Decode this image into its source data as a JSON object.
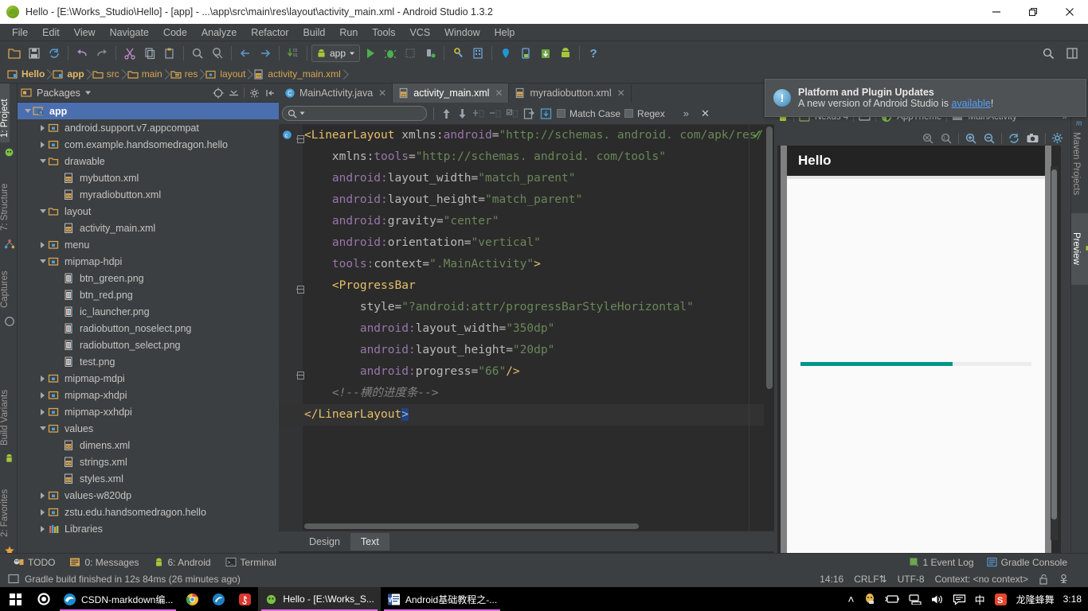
{
  "window": {
    "title": "Hello - [E:\\Works_Studio\\Hello] - [app] - ...\\app\\src\\main\\res\\layout\\activity_main.xml - Android Studio 1.3.2",
    "minimize": "—",
    "maximize": "❐",
    "close": "✕"
  },
  "menubar": {
    "items": [
      "File",
      "Edit",
      "View",
      "Navigate",
      "Code",
      "Analyze",
      "Refactor",
      "Build",
      "Run",
      "Tools",
      "VCS",
      "Window",
      "Help"
    ]
  },
  "toolbar": {
    "run_config": "app",
    "icons": [
      "open-folder-icon",
      "save-all-icon",
      "sync-icon",
      "undo-icon",
      "redo-icon",
      "cut-icon",
      "copy-icon",
      "paste-icon",
      "find-icon",
      "replace-icon",
      "back-icon",
      "forward-icon",
      "compile-icon"
    ],
    "search_everywhere": "search-icon",
    "help": "?"
  },
  "breadcrumb": {
    "items": [
      "Hello",
      "app",
      "src",
      "main",
      "res",
      "layout",
      "activity_main.xml"
    ]
  },
  "left_strip": {
    "tabs": [
      "1: Project",
      "7: Structure",
      "Captures",
      "Build Variants",
      "2: Favorites"
    ],
    "selected": "1: Project"
  },
  "right_strip": {
    "tabs": [
      "dle",
      "Maven Projects",
      "Preview"
    ],
    "selected": "Preview"
  },
  "project_panel": {
    "title": "Packages",
    "tree": [
      {
        "label": "app",
        "depth": 0,
        "arrow": "open",
        "icon": "module-icon",
        "selected": true,
        "bold": true
      },
      {
        "label": "android.support.v7.appcompat",
        "depth": 1,
        "arrow": "closed",
        "icon": "package-icon"
      },
      {
        "label": "com.example.handsomedragon.hello",
        "depth": 1,
        "arrow": "closed",
        "icon": "package-icon"
      },
      {
        "label": "drawable",
        "depth": 1,
        "arrow": "open",
        "icon": "folder-icon"
      },
      {
        "label": "mybutton.xml",
        "depth": 2,
        "arrow": "none",
        "icon": "xml-file-icon"
      },
      {
        "label": "myradiobutton.xml",
        "depth": 2,
        "arrow": "none",
        "icon": "xml-file-icon"
      },
      {
        "label": "layout",
        "depth": 1,
        "arrow": "open",
        "icon": "folder-icon"
      },
      {
        "label": "activity_main.xml",
        "depth": 2,
        "arrow": "none",
        "icon": "xml-file-icon"
      },
      {
        "label": "menu",
        "depth": 1,
        "arrow": "closed",
        "icon": "package-icon"
      },
      {
        "label": "mipmap-hdpi",
        "depth": 1,
        "arrow": "open",
        "icon": "package-icon"
      },
      {
        "label": "btn_green.png",
        "depth": 2,
        "arrow": "none",
        "icon": "image-file-icon"
      },
      {
        "label": "btn_red.png",
        "depth": 2,
        "arrow": "none",
        "icon": "image-file-icon"
      },
      {
        "label": "ic_launcher.png",
        "depth": 2,
        "arrow": "none",
        "icon": "image-file-icon"
      },
      {
        "label": "radiobutton_noselect.png",
        "depth": 2,
        "arrow": "none",
        "icon": "image-file-icon"
      },
      {
        "label": "radiobutton_select.png",
        "depth": 2,
        "arrow": "none",
        "icon": "image-file-icon"
      },
      {
        "label": "test.png",
        "depth": 2,
        "arrow": "none",
        "icon": "image-file-icon"
      },
      {
        "label": "mipmap-mdpi",
        "depth": 1,
        "arrow": "closed",
        "icon": "package-icon"
      },
      {
        "label": "mipmap-xhdpi",
        "depth": 1,
        "arrow": "closed",
        "icon": "package-icon"
      },
      {
        "label": "mipmap-xxhdpi",
        "depth": 1,
        "arrow": "closed",
        "icon": "package-icon"
      },
      {
        "label": "values",
        "depth": 1,
        "arrow": "open",
        "icon": "package-icon"
      },
      {
        "label": "dimens.xml",
        "depth": 2,
        "arrow": "none",
        "icon": "xml-file-icon"
      },
      {
        "label": "strings.xml",
        "depth": 2,
        "arrow": "none",
        "icon": "xml-file-icon"
      },
      {
        "label": "styles.xml",
        "depth": 2,
        "arrow": "none",
        "icon": "xml-file-icon"
      },
      {
        "label": "values-w820dp",
        "depth": 1,
        "arrow": "closed",
        "icon": "package-icon"
      },
      {
        "label": "zstu.edu.handsomedragon.hello",
        "depth": 1,
        "arrow": "closed",
        "icon": "package-icon"
      },
      {
        "label": "Libraries",
        "depth": 1,
        "arrow": "closed",
        "icon": "library-icon"
      }
    ]
  },
  "editor": {
    "tabs": [
      {
        "label": "MainActivity.java",
        "icon": "java-class-icon",
        "active": false
      },
      {
        "label": "activity_main.xml",
        "icon": "xml-file-icon",
        "active": true
      },
      {
        "label": "myradiobutton.xml",
        "icon": "xml-file-icon",
        "active": false
      }
    ],
    "find": {
      "value": "",
      "placeholder": "",
      "match_case": "Match Case",
      "regex": "Regex",
      "more": "»",
      "close": "✕"
    },
    "bottom_tabs": [
      {
        "label": "Design",
        "active": false
      },
      {
        "label": "Text",
        "active": true
      }
    ],
    "code_lines": [
      [
        {
          "t": "<LinearLayout ",
          "c": "tag"
        },
        {
          "t": "xmlns:",
          "c": "attr"
        },
        {
          "t": "android",
          "c": "ns"
        },
        {
          "t": "=",
          "c": "attr"
        },
        {
          "t": "\"http://schemas. android. com/apk/res/",
          "c": "val"
        }
      ],
      [
        {
          "t": "    xmlns:",
          "c": "attr"
        },
        {
          "t": "tools",
          "c": "ns"
        },
        {
          "t": "=",
          "c": "attr"
        },
        {
          "t": "\"http://schemas. android. com/tools\"",
          "c": "val"
        }
      ],
      [
        {
          "t": "    android:",
          "c": "ns"
        },
        {
          "t": "layout_width",
          "c": "attr"
        },
        {
          "t": "=",
          "c": "attr"
        },
        {
          "t": "\"match_parent\"",
          "c": "val"
        }
      ],
      [
        {
          "t": "    android:",
          "c": "ns"
        },
        {
          "t": "layout_height",
          "c": "attr"
        },
        {
          "t": "=",
          "c": "attr"
        },
        {
          "t": "\"match_parent\"",
          "c": "val"
        }
      ],
      [
        {
          "t": "    android:",
          "c": "ns"
        },
        {
          "t": "gravity",
          "c": "attr"
        },
        {
          "t": "=",
          "c": "attr"
        },
        {
          "t": "\"center\"",
          "c": "val"
        }
      ],
      [
        {
          "t": "    android:",
          "c": "ns"
        },
        {
          "t": "orientation",
          "c": "attr"
        },
        {
          "t": "=",
          "c": "attr"
        },
        {
          "t": "\"vertical\"",
          "c": "val"
        }
      ],
      [
        {
          "t": "    tools:",
          "c": "ns"
        },
        {
          "t": "context",
          "c": "attr"
        },
        {
          "t": "=",
          "c": "attr"
        },
        {
          "t": "\".MainActivity\"",
          "c": "val"
        },
        {
          "t": ">",
          "c": "tag"
        }
      ],
      [
        {
          "t": "    <ProgressBar",
          "c": "tag"
        }
      ],
      [
        {
          "t": "        style",
          "c": "attr"
        },
        {
          "t": "=",
          "c": "attr"
        },
        {
          "t": "\"?android:attr/progressBarStyleHorizontal\"",
          "c": "val"
        }
      ],
      [
        {
          "t": "        android:",
          "c": "ns"
        },
        {
          "t": "layout_width",
          "c": "attr"
        },
        {
          "t": "=",
          "c": "attr"
        },
        {
          "t": "\"350dp\"",
          "c": "val"
        }
      ],
      [
        {
          "t": "        android:",
          "c": "ns"
        },
        {
          "t": "layout_height",
          "c": "attr"
        },
        {
          "t": "=",
          "c": "attr"
        },
        {
          "t": "\"20dp\"",
          "c": "val"
        }
      ],
      [
        {
          "t": "        android:",
          "c": "ns"
        },
        {
          "t": "progress",
          "c": "attr"
        },
        {
          "t": "=",
          "c": "attr"
        },
        {
          "t": "\"66\"",
          "c": "val"
        },
        {
          "t": "/>",
          "c": "tag"
        }
      ],
      [
        {
          "t": "    <!--横的进度条-->",
          "c": "cmt"
        }
      ],
      [
        {
          "t": "</LinearLayout",
          "c": "tag"
        },
        {
          "t": ">",
          "c": "punct"
        }
      ]
    ]
  },
  "notification": {
    "icon": "info-icon",
    "title": "Platform and Plugin Updates",
    "message_before": "A new version of Android Studio is ",
    "link": "available",
    "message_after": "!"
  },
  "preview": {
    "device": "Nexus 4",
    "theme": "AppTheme",
    "activity": "MainActivity",
    "toolbar_icons": [
      "zoom-fit-icon",
      "zoom-actual-icon",
      "zoom-in-icon",
      "zoom-out-icon",
      "refresh-icon",
      "screenshot-icon",
      "settings-icon"
    ],
    "app_title": "Hello",
    "progress_percent": 66,
    "progress_color": "#009688"
  },
  "bottom_strip": {
    "left": [
      {
        "label": "TODO",
        "icon": "todo-icon"
      },
      {
        "label": "0: Messages",
        "icon": "messages-icon"
      },
      {
        "label": "6: Android",
        "icon": "android-icon"
      },
      {
        "label": "Terminal",
        "icon": "terminal-icon"
      }
    ],
    "right": [
      {
        "label": "1 Event Log",
        "icon": "event-log-icon"
      },
      {
        "label": "Gradle Console",
        "icon": "gradle-console-icon"
      }
    ]
  },
  "statusbar": {
    "message": "Gradle build finished in 12s 84ms (26 minutes ago)",
    "caret": "14:16",
    "line_sep": "CRLF⇅",
    "encoding": "UTF-8",
    "context": "Context: <no context>",
    "lock_icon": "unlock-icon",
    "inspection_icon": "hector-icon"
  },
  "taskbar": {
    "start": "start-button",
    "items": [
      {
        "label": "",
        "icon": "cortana-icon",
        "active": false,
        "running": false
      },
      {
        "label": "CSDN-markdown编...",
        "icon": "edge-icon",
        "active": false,
        "running": true
      },
      {
        "label": "",
        "icon": "chrome-icon",
        "active": false,
        "running": false
      },
      {
        "label": "",
        "icon": "browser-icon",
        "active": false,
        "running": false
      },
      {
        "label": "",
        "icon": "netease-music-icon",
        "active": false,
        "running": false
      },
      {
        "label": "Hello - [E:\\Works_S...",
        "icon": "android-studio-icon",
        "active": true,
        "running": true
      },
      {
        "label": "Android基础教程之-...",
        "icon": "word-icon",
        "active": false,
        "running": true
      }
    ],
    "tray": {
      "chevron": "˄",
      "icons": [
        "qq-icon",
        "battery-icon",
        "network-icon",
        "volume-icon",
        "action-center-icon"
      ],
      "ime": "中",
      "sogou": "sogou-icon",
      "user": "龙隆蜂舞",
      "time": "3:18"
    }
  },
  "colors": {
    "accent": "#4b6eaf",
    "folder": "#d6a552",
    "teal": "#009688",
    "link": "#589df6"
  }
}
